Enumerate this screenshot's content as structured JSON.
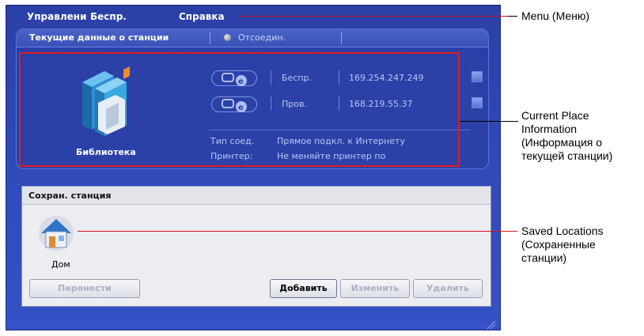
{
  "menu": {
    "items": [
      "Управлени",
      "Беспр.",
      "Справка"
    ]
  },
  "current_panel": {
    "title": "Текущие данные о станции",
    "status": "Отсоедин.",
    "location_name": "Библиотека",
    "wireless_label": "Беспр.",
    "wireless_ip": "169.254.247.249",
    "wired_label": "Пров.",
    "wired_ip": "168.219.55.37",
    "conn_type_label": "Тип соед.",
    "conn_type_value": "Прямое подкл. к Интернету",
    "printer_label": "Принтер:",
    "printer_value": "Не меняйте принтер по"
  },
  "saved_panel": {
    "title": "Сохран. станция",
    "items": [
      "Дом"
    ]
  },
  "buttons": {
    "transfer": "Перенести",
    "add": "Добавить",
    "edit": "Изменить",
    "delete": "Удалить"
  },
  "annotations": {
    "menu": "Menu (Меню)",
    "current_1": "Current Place",
    "current_2": "Information",
    "current_3": "(Информация о",
    "current_4": "текущей станции)",
    "saved_1": "Saved Locations",
    "saved_2": "(Сохраненные",
    "saved_3": "станции)"
  },
  "colors": {
    "app_bg": "#2f49b8",
    "highlight": "#e3191f",
    "saved_bg": "#ecedf1"
  }
}
